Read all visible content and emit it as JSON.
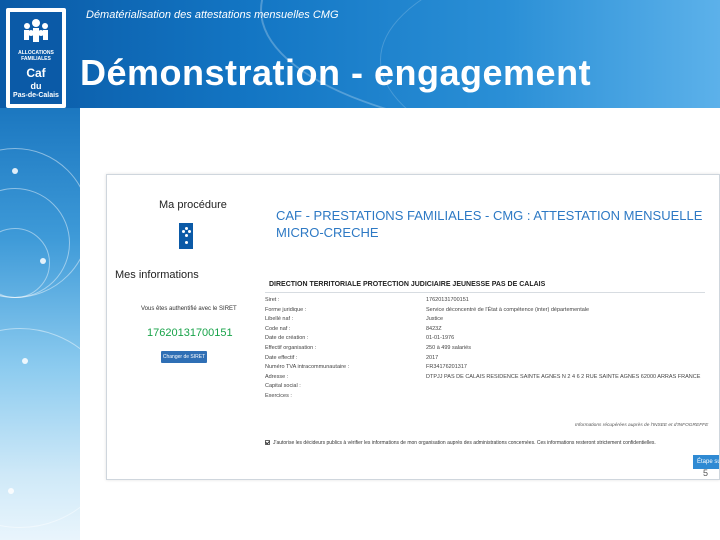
{
  "header": {
    "subtitle": "Dématérialisation des attestations mensuelles CMG",
    "title": "Démonstration - engagement"
  },
  "logo": {
    "line1": "ALLOCATIONS",
    "line2": "FAMILIALES",
    "line3": "Caf",
    "line4": "du",
    "line5": "Pas-de-Calais",
    "brand_color": "#0b5aa7"
  },
  "screenshot": {
    "sidebar": {
      "procedure_heading": "Ma procédure",
      "info_heading": "Mes informations",
      "auth_label": "Vous êtes authentifié avec le SIRET",
      "siret": "17620131700151",
      "change_button": "Changer de SIRET"
    },
    "main": {
      "procedure_title": "CAF - PRESTATIONS FAMILIALES - CMG : ATTESTATION MENSUELLE MICRO-CRECHE",
      "organization": "DIRECTION TERRITORIALE PROTECTION JUDICIAIRE JEUNESSE PAS DE CALAIS",
      "rows": [
        {
          "label": "Siret :",
          "value": "17620131700151"
        },
        {
          "label": "Forme juridique :",
          "value": "Service déconcentré de l'État à compétence (inter) départementale"
        },
        {
          "label": "Libellé naf :",
          "value": "Justice"
        },
        {
          "label": "Code naf :",
          "value": "8423Z"
        },
        {
          "label": "Date de création :",
          "value": "01-01-1976"
        },
        {
          "label": "Effectif organisation :",
          "value": "250 à 499 salariés"
        },
        {
          "label": "Date effectif :",
          "value": "2017"
        },
        {
          "label": "Numéro TVA intracommunautaire :",
          "value": "FR34176201317"
        },
        {
          "label": "Adresse :",
          "value": "DTPJJ PAS DE CALAIS RESIDENCE SAINTE AGNES N 2 4 6 2 RUE SAINTE AGNES 62000 ARRAS FRANCE"
        },
        {
          "label": "Capital social :",
          "value": ""
        },
        {
          "label": "Exercices :",
          "value": ""
        }
      ],
      "insee_note": "Informations récupérées auprès de l'INSEE et d'INFOGREFFE",
      "consent_text": "J'autorise les décideurs publics à vérifier les informations de mon organisation auprès des administrations concernées. Ces informations resteront strictement confidentielles.",
      "next_button": "Étape suiv"
    }
  },
  "page_number": "5",
  "colors": {
    "header_blue": "#1376c4",
    "title_blue": "#2d79c4",
    "siret_green": "#19a34a",
    "button_blue": "#2f8ad3"
  }
}
